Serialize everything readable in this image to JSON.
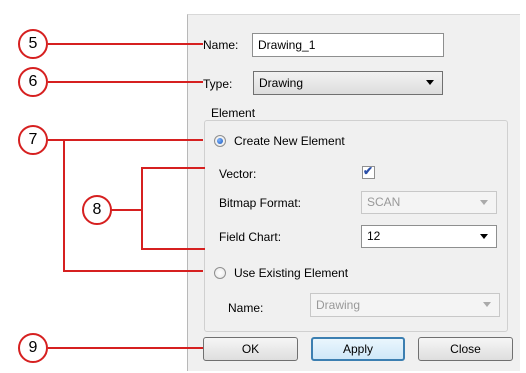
{
  "form": {
    "name_label": "Name:",
    "name_value": "Drawing_1",
    "type_label": "Type:",
    "type_value": "Drawing"
  },
  "element_group": {
    "title": "Element",
    "create_new_label": "Create New Element",
    "create_new_selected": true,
    "vector_label": "Vector:",
    "vector_checked": true,
    "bitmap_format_label": "Bitmap Format:",
    "bitmap_format_value": "SCAN",
    "field_chart_label": "Field Chart:",
    "field_chart_value": "12",
    "use_existing_label": "Use Existing Element",
    "use_existing_selected": false,
    "existing_name_label": "Name:",
    "existing_name_value": "Drawing"
  },
  "buttons": {
    "ok": "OK",
    "apply": "Apply",
    "close": "Close"
  },
  "callouts": {
    "c5": "5",
    "c6": "6",
    "c7": "7",
    "c8": "8",
    "c9": "9"
  },
  "colors": {
    "callout_red": "#d62020",
    "panel_bg": "#f0f0f0"
  }
}
